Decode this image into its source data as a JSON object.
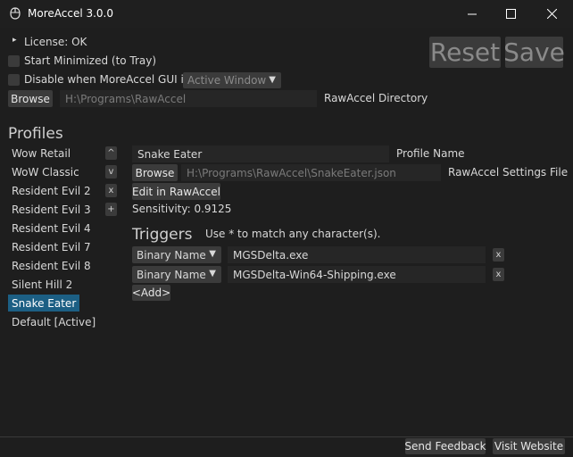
{
  "window": {
    "title": "MoreAccel 3.0.0",
    "icon": "app-icon",
    "minimize": "—",
    "maximize": "☐",
    "close": "✕"
  },
  "license": {
    "arrow": "▸",
    "text": "License: OK"
  },
  "options": {
    "start_minimized": "Start Minimized (to Tray)",
    "disable_when": "Disable when MoreAccel GUI is",
    "disable_mode": "Active Window"
  },
  "rawaccel": {
    "browse": "Browse",
    "path": "H:\\Programs\\RawAccel",
    "label": "RawAccel Directory"
  },
  "actions": {
    "reset": "Reset",
    "save": "Save"
  },
  "profiles": {
    "heading": "Profiles",
    "items": [
      "Wow Retail",
      "WoW Classic",
      "Resident Evil 2",
      "Resident Evil 3",
      "Resident Evil 4",
      "Resident Evil 7",
      "Resident Evil 8",
      "Silent Hill 2",
      "Snake Eater",
      "Default [Active]"
    ],
    "selected_index": 8,
    "controls": {
      "up": "^",
      "down": "v",
      "delete": "x",
      "add": "+"
    }
  },
  "profile": {
    "name": "Snake Eater",
    "name_label": "Profile Name",
    "browse": "Browse",
    "settings_path": "H:\\Programs\\RawAccel\\SnakeEater.json",
    "settings_label": "RawAccel Settings File",
    "edit": "Edit in RawAccel",
    "sensitivity": "Sensitivity: 0.9125"
  },
  "triggers": {
    "heading": "Triggers",
    "hint": "Use * to match any character(s).",
    "rows": [
      {
        "type": "Binary Name",
        "value": "MGSDelta.exe",
        "remove": "x"
      },
      {
        "type": "Binary Name",
        "value": "MGSDelta-Win64-Shipping.exe",
        "remove": "x"
      }
    ],
    "add": "<Add>"
  },
  "footer": {
    "feedback": "Send Feedback",
    "website": "Visit Website"
  },
  "colors": {
    "background": "#1e1e1e",
    "selection": "#1c5f84",
    "control": "#3b3b3b"
  }
}
